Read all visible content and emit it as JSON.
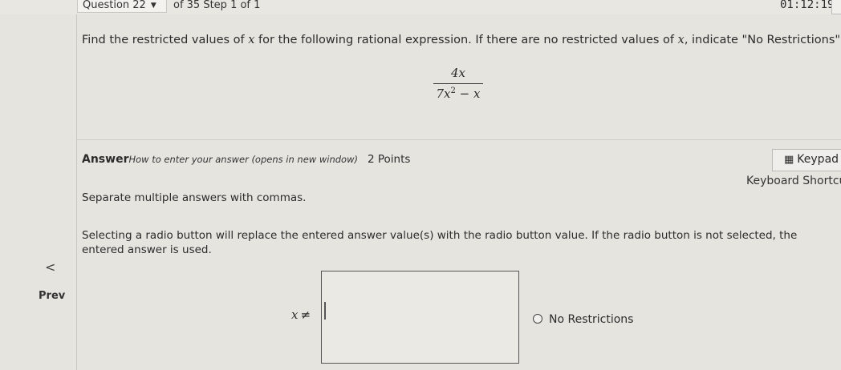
{
  "header": {
    "question_label": "Question 22",
    "step_text": "of 35 Step 1 of 1",
    "timer": "01:12:19"
  },
  "question": {
    "prefix": "Find the restricted values of ",
    "var1": "x",
    "middle": " for the following rational expression. If there are no restricted values of ",
    "var2": "x",
    "suffix": ", indicate \"No Restrictions\".",
    "numerator": "4x",
    "denominator_base": "7x",
    "denominator_exp": "2",
    "denominator_rest": " − x"
  },
  "answer": {
    "label": "Answer",
    "help_link": "How to enter your answer (opens in new window)",
    "points": "2 Points",
    "keypad_label": "Keypad",
    "shortcuts_label": "Keyboard Shortcu",
    "instruction1": "Separate multiple answers with commas.",
    "instruction2": "Selecting a radio button will replace the entered answer value(s) with the radio button value. If the radio button is not selected, the entered answer is used.",
    "input_value": "",
    "x_var": "x",
    "neq_symbol": "≠",
    "radio_label": "No Restrictions"
  },
  "nav": {
    "prev_chevron": "<",
    "prev_label": "Prev"
  }
}
